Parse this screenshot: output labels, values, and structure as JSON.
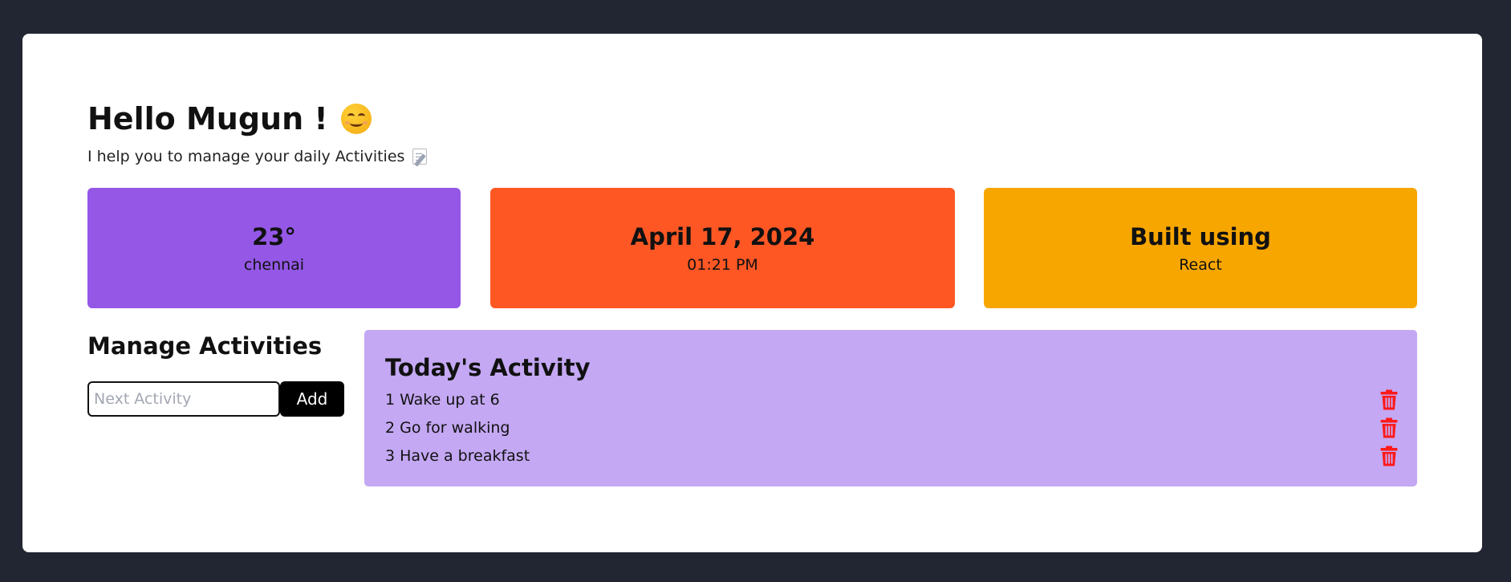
{
  "header": {
    "greeting": "Hello Mugun !",
    "emoji": "smiling-face-icon",
    "subtitle": "I help you to manage your daily Activities",
    "subtitle_icon": "memo-icon"
  },
  "tiles": {
    "weather": {
      "value": "23°",
      "label": "chennai",
      "color": "#9457e6"
    },
    "datetime": {
      "value": "April 17, 2024",
      "label": "01:21 PM",
      "color": "#ff5724"
    },
    "built": {
      "value": "Built using",
      "label": "React",
      "color": "#f7a600"
    }
  },
  "manage": {
    "title": "Manage Activities",
    "input_placeholder": "Next Activity",
    "input_value": "",
    "add_label": "Add"
  },
  "activities": {
    "title": "Today's Activity",
    "panel_color": "#c4a8f3",
    "delete_icon": "trash-icon",
    "delete_color": "#ff1a1a",
    "items": [
      {
        "num": "1",
        "text": "Wake up at 6"
      },
      {
        "num": "2",
        "text": "Go for walking"
      },
      {
        "num": "3",
        "text": "Have a breakfast"
      }
    ]
  }
}
